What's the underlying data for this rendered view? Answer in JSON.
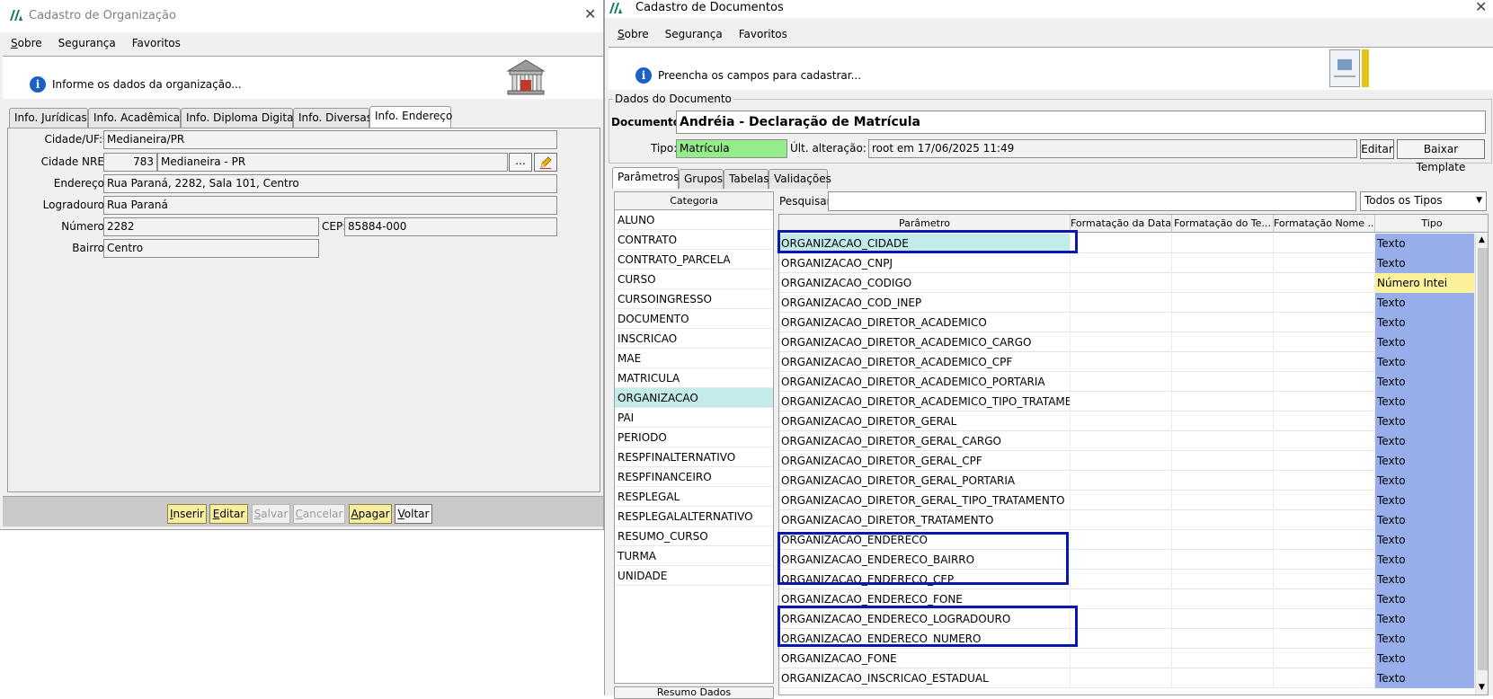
{
  "org_window": {
    "title": "Cadastro de Organização",
    "close": "✕",
    "menu": [
      "Sobre",
      "Segurança",
      "Favoritos"
    ],
    "info_text": "Informe os dados da organização...",
    "tabs": [
      "Info. Jurídicas",
      "Info. Acadêmicas",
      "Info. Diploma Digital",
      "Info. Diversas",
      "Info. Endereço"
    ],
    "active_tab": "Info. Endereço",
    "fields": {
      "cidade_uf_label": "Cidade/UF:*",
      "cidade_uf_value": "Medianeira/PR",
      "cidade_nre_label": "Cidade NRE:",
      "cidade_nre_code": "783",
      "cidade_nre_value": "Medianeira - PR",
      "nre_lookup_btn": "...",
      "endereco_label": "Endereço:",
      "endereco_value": "Rua Paraná, 2282, Sala 101, Centro",
      "logradouro_label": "Logradouro:",
      "logradouro_value": "Rua Paraná",
      "numero_label": "Número:",
      "numero_value": "2282",
      "cep_label": "CEP:",
      "cep_value": "85884-000",
      "bairro_label": "Bairro:",
      "bairro_value": "Centro"
    },
    "buttons": {
      "inserir": "Inserir",
      "editar": "Editar",
      "salvar": "Salvar",
      "cancelar": "Cancelar",
      "apagar": "Apagar",
      "voltar": "Voltar"
    }
  },
  "doc_window": {
    "title": "Cadastro de Documentos",
    "close": "✕",
    "menu": [
      "Sobre",
      "Segurança",
      "Favoritos"
    ],
    "info_text": "Preencha os campos para cadastrar...",
    "group_title": "Dados do Documento",
    "documento_label": "Documento:",
    "documento_value": "Andréia - Declaração de Matrícula",
    "tipo_label": "Tipo:",
    "tipo_value": "Matrícula",
    "ult_alteracao_label": "Últ. alteração:",
    "ult_alteracao_value": "root em 17/06/2025 11:49",
    "editar_btn": "Editar",
    "baixar_btn": "Baixar Template",
    "tabs": [
      "Parâmetros",
      "Grupos",
      "Tabelas",
      "Validações"
    ],
    "active_tab": "Parâmetros",
    "categoria_header": "Categoria",
    "categories": [
      "ALUNO",
      "CONTRATO",
      "CONTRATO_PARCELA",
      "CURSO",
      "CURSOINGRESSO",
      "DOCUMENTO",
      "INSCRICAO",
      "MAE",
      "MATRICULA",
      "ORGANIZACAO",
      "PAI",
      "PERIODO",
      "RESPFINALTERNATIVO",
      "RESPFINANCEIRO",
      "RESPLEGAL",
      "RESPLEGALALTERNATIVO",
      "RESUMO_CURSO",
      "TURMA",
      "UNIDADE"
    ],
    "selected_category": "ORGANIZACAO",
    "bottom_partial_label": "Resumo Dados",
    "pesquisar_label": "Pesquisar:",
    "pesquisar_value": "",
    "tipo_filter": "Todos os Tipos",
    "columns": [
      "Parâmetro",
      "Formatação da Data",
      "Formatação do Te...",
      "Formatação Nome ...",
      "Tipo"
    ],
    "rows": [
      {
        "param": "ORGANIZACAO_CIDADE",
        "tipo": "Texto"
      },
      {
        "param": "ORGANIZACAO_CNPJ",
        "tipo": "Texto"
      },
      {
        "param": "ORGANIZACAO_CODIGO",
        "tipo": "Número Intei"
      },
      {
        "param": "ORGANIZACAO_COD_INEP",
        "tipo": "Texto"
      },
      {
        "param": "ORGANIZACAO_DIRETOR_ACADEMICO",
        "tipo": "Texto"
      },
      {
        "param": "ORGANIZACAO_DIRETOR_ACADEMICO_CARGO",
        "tipo": "Texto"
      },
      {
        "param": "ORGANIZACAO_DIRETOR_ACADEMICO_CPF",
        "tipo": "Texto"
      },
      {
        "param": "ORGANIZACAO_DIRETOR_ACADEMICO_PORTARIA",
        "tipo": "Texto"
      },
      {
        "param": "ORGANIZACAO_DIRETOR_ACADEMICO_TIPO_TRATAMENTO",
        "tipo": "Texto"
      },
      {
        "param": "ORGANIZACAO_DIRETOR_GERAL",
        "tipo": "Texto"
      },
      {
        "param": "ORGANIZACAO_DIRETOR_GERAL_CARGO",
        "tipo": "Texto"
      },
      {
        "param": "ORGANIZACAO_DIRETOR_GERAL_CPF",
        "tipo": "Texto"
      },
      {
        "param": "ORGANIZACAO_DIRETOR_GERAL_PORTARIA",
        "tipo": "Texto"
      },
      {
        "param": "ORGANIZACAO_DIRETOR_GERAL_TIPO_TRATAMENTO",
        "tipo": "Texto"
      },
      {
        "param": "ORGANIZACAO_DIRETOR_TRATAMENTO",
        "tipo": "Texto"
      },
      {
        "param": "ORGANIZACAO_ENDERECO",
        "tipo": "Texto"
      },
      {
        "param": "ORGANIZACAO_ENDERECO_BAIRRO",
        "tipo": "Texto"
      },
      {
        "param": "ORGANIZACAO_ENDERECO_CEP",
        "tipo": "Texto"
      },
      {
        "param": "ORGANIZACAO_ENDERECO_FONE",
        "tipo": "Texto"
      },
      {
        "param": "ORGANIZACAO_ENDERECO_LOGRADOURO",
        "tipo": "Texto"
      },
      {
        "param": "ORGANIZACAO_ENDERECO_NUMERO",
        "tipo": "Texto"
      },
      {
        "param": "ORGANIZACAO_FONE",
        "tipo": "Texto"
      },
      {
        "param": "ORGANIZACAO_INSCRICAO_ESTADUAL",
        "tipo": "Texto"
      }
    ],
    "selected_row": "ORGANIZACAO_CIDADE"
  },
  "colors": {
    "tipo_texto": "#97aeea",
    "tipo_numero": "#fbf19d",
    "selected_row": "#c3ebe9",
    "tipo_field": "#95ec8b",
    "highlight_box": "#0a16b0",
    "yellow_button": "#f7ef9d"
  }
}
